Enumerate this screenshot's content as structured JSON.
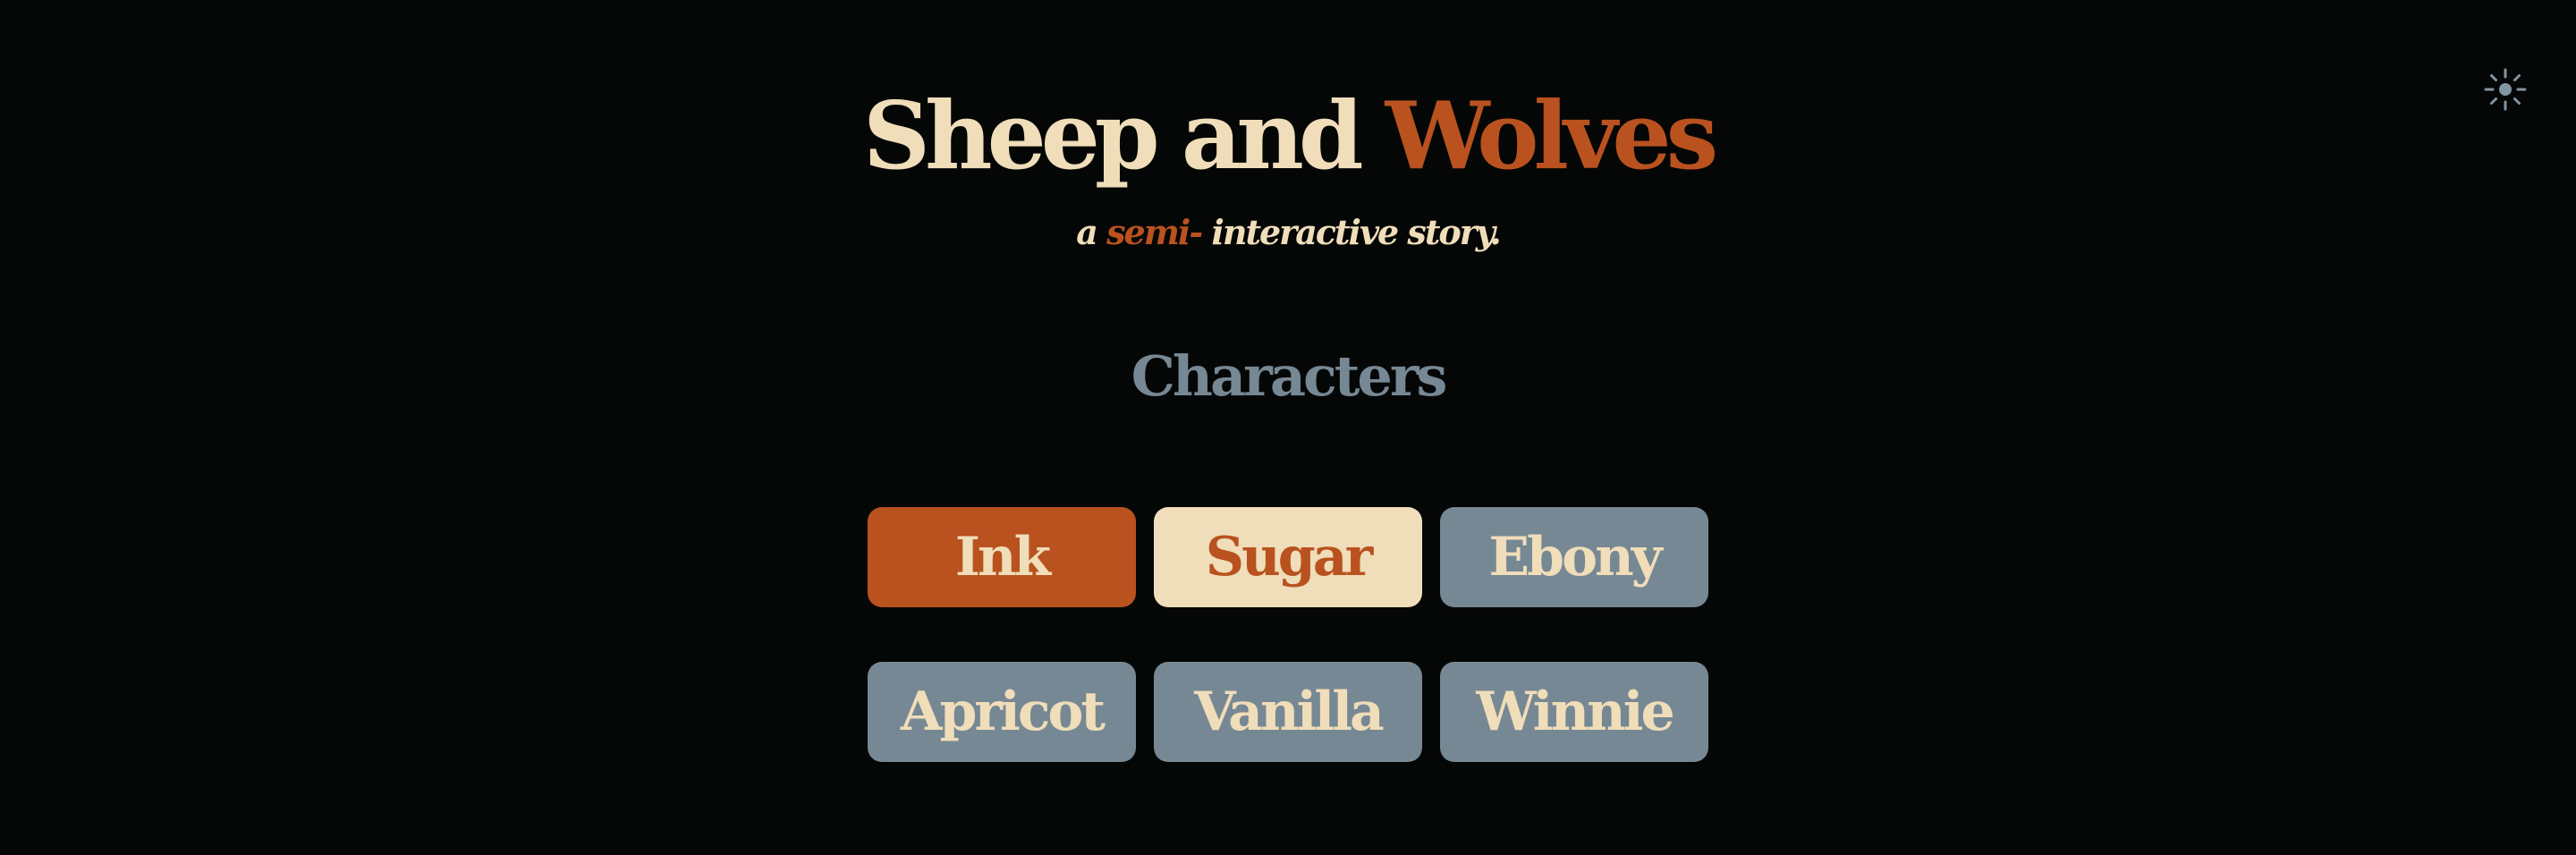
{
  "theme_toggle": {
    "icon": "sun-icon"
  },
  "header": {
    "title_part1": "Sheep and ",
    "title_part2": "Wolves",
    "subtitle_part1": "a ",
    "subtitle_part2": "semi-",
    "subtitle_part3": " interactive story."
  },
  "section": {
    "heading": "Characters"
  },
  "characters": [
    {
      "name": "Ink",
      "bg": "#B9521F",
      "fg": "#F0DDB9"
    },
    {
      "name": "Sugar",
      "bg": "#F0DDB9",
      "fg": "#B9521F"
    },
    {
      "name": "Ebony",
      "bg": "#768894",
      "fg": "#F0DDB9"
    },
    {
      "name": "Apricot",
      "bg": "#768894",
      "fg": "#F0DDB9"
    },
    {
      "name": "Vanilla",
      "bg": "#768894",
      "fg": "#F0DDB9"
    },
    {
      "name": "Winnie",
      "bg": "#768894",
      "fg": "#F0DDB9"
    }
  ],
  "colors": {
    "background": "#050706",
    "cream": "#F0DDB9",
    "rust": "#B9521F",
    "slate": "#768894"
  }
}
